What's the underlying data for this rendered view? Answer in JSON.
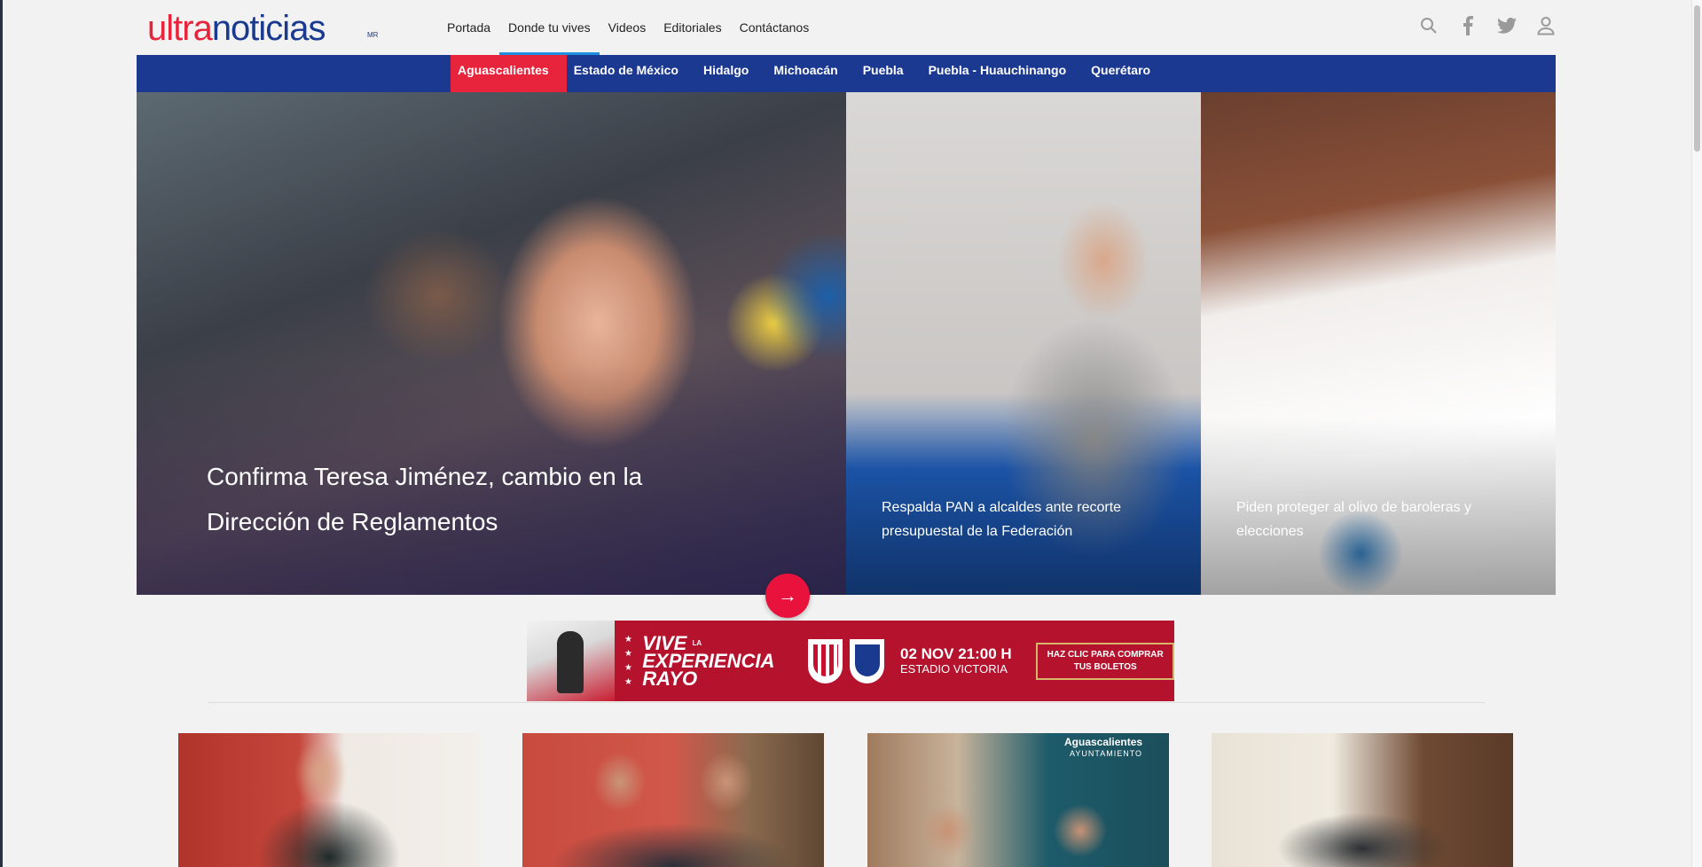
{
  "brand": {
    "logo_part1": "ultra",
    "logo_part2": "noticias",
    "logo_mark": "MR",
    "accent": "#e8243c",
    "navy": "#1c3992"
  },
  "topnav": {
    "items": [
      {
        "label": "Portada"
      },
      {
        "label": "Donde tu vives",
        "active": true
      },
      {
        "label": "Videos"
      },
      {
        "label": "Editoriales"
      },
      {
        "label": "Contáctanos"
      }
    ]
  },
  "header_icons": [
    "search-icon",
    "facebook-icon",
    "twitter-icon",
    "user-icon"
  ],
  "regions": {
    "items": [
      {
        "label": "Aguascalientes",
        "active": true
      },
      {
        "label": "Estado de México"
      },
      {
        "label": "Hidalgo"
      },
      {
        "label": "Michoacán"
      },
      {
        "label": "Puebla"
      },
      {
        "label": "Puebla - Huauchinango"
      },
      {
        "label": "Querétaro"
      }
    ]
  },
  "hero": {
    "main_title": "Confirma Teresa Jiménez, cambio en la Dirección de Reglamentos",
    "side": [
      {
        "title": "Respalda PAN a alcaldes ante recorte presupuestal de la Federación"
      },
      {
        "title": "Piden proteger al olivo de baroleras y elecciones"
      }
    ]
  },
  "banner": {
    "vive_small": "LA",
    "vive": "VIVE",
    "line2": "EXPERIENCIA",
    "line3": "RAYO",
    "date": "02 NOV 21:00 H",
    "venue": "ESTADIO VICTORIA",
    "cta": "HAZ CLIC PARA COMPRAR TUS BOLETOS"
  },
  "thumbs": {
    "t3_logo": "Aguascalientes",
    "t3_sub": "AYUNTAMIENTO"
  }
}
